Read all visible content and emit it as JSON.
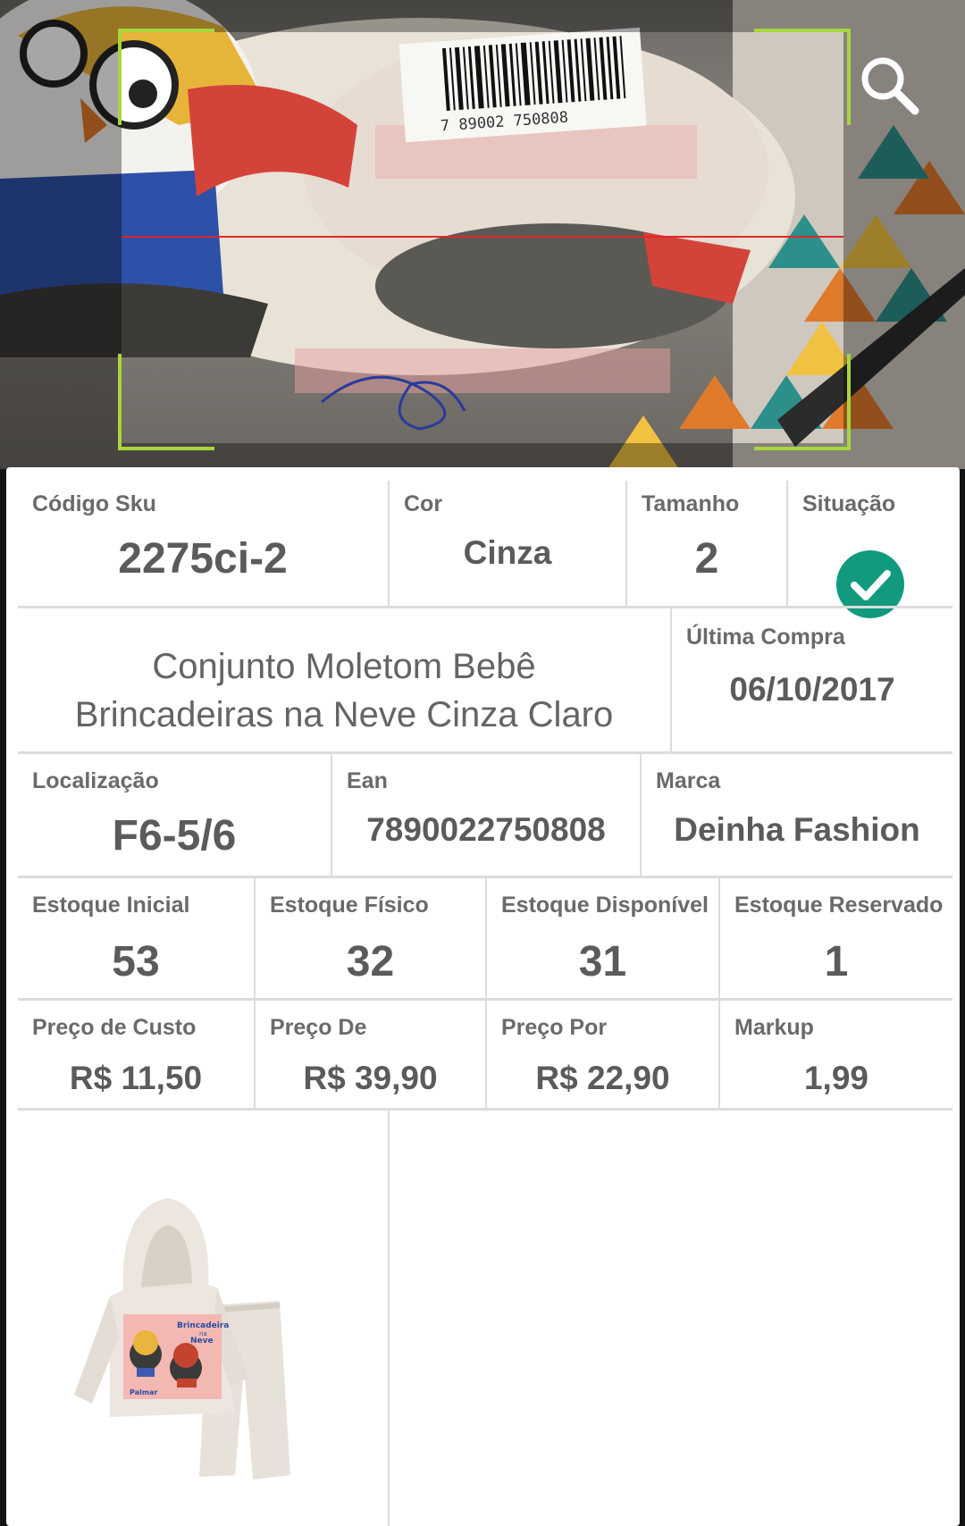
{
  "camera": {
    "barcode_digits": "7 89002 750808",
    "search_icon": "search-icon",
    "colors": {
      "frame": "#a7d63a",
      "scan_line": "#e0262b"
    }
  },
  "product": {
    "sku": {
      "label": "Código Sku",
      "value": "2275ci-2"
    },
    "color": {
      "label": "Cor",
      "value": "Cinza"
    },
    "size": {
      "label": "Tamanho",
      "value": "2"
    },
    "status": {
      "label": "Situação",
      "icon": "check-circle-icon",
      "color": "#129a7f"
    },
    "name_line1": "Conjunto Moletom Bebê",
    "name_line2": "Brincadeiras na Neve Cinza Claro",
    "last_purchase": {
      "label": "Última Compra",
      "value": "06/10/2017"
    },
    "location": {
      "label": "Localização",
      "value": "F6-5/6"
    },
    "ean": {
      "label": "Ean",
      "value": "7890022750808"
    },
    "brand": {
      "label": "Marca",
      "value": "Deinha Fashion"
    },
    "stock": [
      {
        "label": "Estoque Inicial",
        "value": "53"
      },
      {
        "label": "Estoque Físico",
        "value": "32"
      },
      {
        "label": "Estoque Disponível",
        "value": "31"
      },
      {
        "label": "Estoque Reservado",
        "value": "1"
      }
    ],
    "prices": [
      {
        "label": "Preço de Custo",
        "value": "R$ 11,50"
      },
      {
        "label": "Preço De",
        "value": "R$ 39,90"
      },
      {
        "label": "Preço Por",
        "value": "R$ 22,90"
      },
      {
        "label": "Markup",
        "value": "1,99"
      }
    ],
    "image_text": {
      "line1": "Brincadeira",
      "line2": "na",
      "line3": "Neve",
      "brand": "Palmar"
    }
  }
}
